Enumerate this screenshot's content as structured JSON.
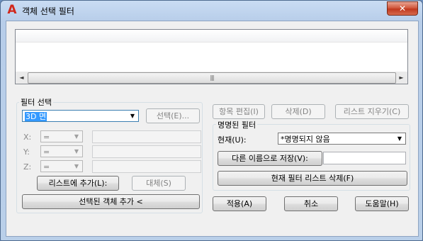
{
  "window": {
    "title": "객체 선택 필터",
    "close_glyph": "✕",
    "app_icon_glyph": "A"
  },
  "filter_list": {
    "scroll_left": "◄",
    "scroll_right": "►",
    "thumb_grip": "|||"
  },
  "selection_group": {
    "label": "필터 선택",
    "type_value": "3D 면",
    "select_button": "선택(E)...",
    "x_label": "X:",
    "y_label": "Y:",
    "z_label": "Z:",
    "x_op": "=",
    "y_op": "=",
    "z_op": "=",
    "add_to_list_button": "리스트에 추가(L):",
    "substitute_button": "대체(S)",
    "add_selected_button": "선택된 객체 추가 <"
  },
  "list_actions": {
    "edit_item_button": "항목 편집(I)",
    "delete_button": "삭제(D)",
    "clear_list_button": "리스트 지우기(C)"
  },
  "named_group": {
    "label": "명명된 필터",
    "current_label": "현재(U):",
    "current_value": "*명명되지 않음",
    "save_as_button": "다른 이름으로 저장(V):",
    "delete_current_button": "현재 필터 리스트 삭제(F)"
  },
  "footer": {
    "apply_button": "적용(A)",
    "cancel_button": "취소",
    "help_button": "도움말(H)"
  },
  "colors": {
    "title_icon": "#d1281c",
    "close_button": "#c0391f",
    "selection_highlight": "#3399ff"
  }
}
